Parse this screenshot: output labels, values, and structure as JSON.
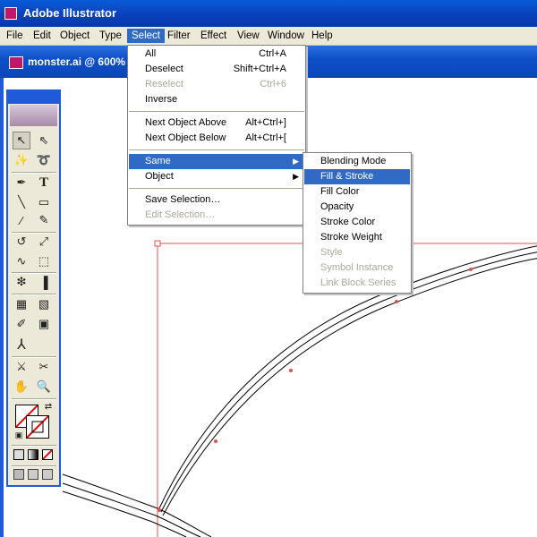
{
  "app": {
    "title": "Adobe Illustrator"
  },
  "document": {
    "title": "monster.ai @ 600%"
  },
  "menubar": {
    "items": [
      "File",
      "Edit",
      "Object",
      "Type",
      "Select",
      "Filter",
      "Effect",
      "View",
      "Window",
      "Help"
    ],
    "active": "Select"
  },
  "select_menu": {
    "items": [
      {
        "label": "All",
        "shortcut": "Ctrl+A",
        "enabled": true
      },
      {
        "label": "Deselect",
        "shortcut": "Shift+Ctrl+A",
        "enabled": true
      },
      {
        "label": "Reselect",
        "shortcut": "Ctrl+6",
        "enabled": false
      },
      {
        "label": "Inverse",
        "shortcut": "",
        "enabled": true
      },
      {
        "label": "Next Object Above",
        "shortcut": "Alt+Ctrl+]",
        "enabled": true
      },
      {
        "label": "Next Object Below",
        "shortcut": "Alt+Ctrl+[",
        "enabled": true
      },
      {
        "label": "Same",
        "shortcut": "",
        "enabled": true,
        "submenu": true,
        "highlighted": true
      },
      {
        "label": "Object",
        "shortcut": "",
        "enabled": true,
        "submenu": true
      },
      {
        "label": "Save Selection…",
        "shortcut": "",
        "enabled": true
      },
      {
        "label": "Edit Selection…",
        "shortcut": "",
        "enabled": false
      }
    ]
  },
  "same_submenu": {
    "items": [
      {
        "label": "Blending Mode",
        "enabled": true
      },
      {
        "label": "Fill & Stroke",
        "enabled": true,
        "highlighted": true
      },
      {
        "label": "Fill Color",
        "enabled": true
      },
      {
        "label": "Opacity",
        "enabled": true
      },
      {
        "label": "Stroke Color",
        "enabled": true
      },
      {
        "label": "Stroke Weight",
        "enabled": true
      },
      {
        "label": "Style",
        "enabled": false
      },
      {
        "label": "Symbol Instance",
        "enabled": false
      },
      {
        "label": "Link Block Series",
        "enabled": false
      }
    ]
  },
  "toolbox": {
    "tools": [
      "selection-tool",
      "direct-selection-tool",
      "magic-wand-tool",
      "lasso-tool",
      "pen-tool",
      "type-tool",
      "line-tool",
      "rectangle-tool",
      "paintbrush-tool",
      "pencil-tool",
      "rotate-tool",
      "scale-tool",
      "warp-tool",
      "free-transform-tool",
      "symbol-sprayer-tool",
      "graph-tool",
      "mesh-tool",
      "gradient-tool",
      "eyedropper-tool",
      "blend-tool",
      "slice-tool",
      "scissors-tool",
      "hand-tool",
      "zoom-tool"
    ]
  },
  "colors": {
    "title_bar": "#0a46c8",
    "menu_highlight": "#316ac5",
    "guide": "#e05050"
  }
}
